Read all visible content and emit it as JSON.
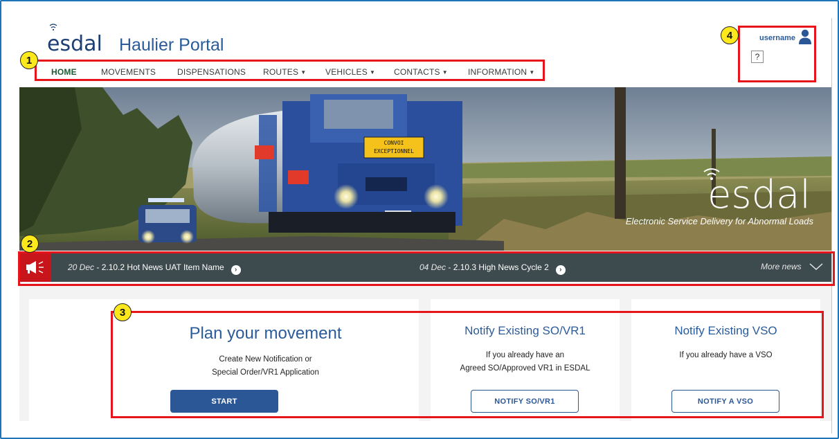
{
  "header": {
    "logo_text": "esdal",
    "portal_title": "Haulier Portal"
  },
  "nav": {
    "items": [
      {
        "label": "HOME",
        "active": true,
        "dropdown": false
      },
      {
        "label": "MOVEMENTS",
        "active": false,
        "dropdown": false
      },
      {
        "label": "DISPENSATIONS",
        "active": false,
        "dropdown": false
      },
      {
        "label": "ROUTES",
        "active": false,
        "dropdown": true
      },
      {
        "label": "VEHICLES",
        "active": false,
        "dropdown": true
      },
      {
        "label": "CONTACTS",
        "active": false,
        "dropdown": true
      },
      {
        "label": "INFORMATION",
        "active": false,
        "dropdown": true
      }
    ]
  },
  "user": {
    "username": "username",
    "help_label": "?",
    "icon": "user-icon"
  },
  "hero": {
    "logo_text": "esdal",
    "tagline": "Electronic Service Delivery for Abnormal Loads",
    "truck_sign_line1": "CONVOI",
    "truck_sign_line2": "EXCEPTIONNEL"
  },
  "news": {
    "icon": "megaphone-icon",
    "items": [
      {
        "date": "20 Dec",
        "separator": " - ",
        "title": "2.10.2 Hot News UAT Item Name"
      },
      {
        "date": "04 Dec",
        "separator": " - ",
        "title": "2.10.3 High News Cycle 2"
      }
    ],
    "more_label": "More news"
  },
  "cards": [
    {
      "title": "Plan your movement",
      "desc_line1": "Create New Notification or",
      "desc_line2": "Special Order/VR1 Application",
      "button": "START"
    },
    {
      "title": "Notify Existing SO/VR1",
      "desc_line1": "If you already have an",
      "desc_line2": "Agreed SO/Approved VR1 in ESDAL",
      "button": "NOTIFY SO/VR1"
    },
    {
      "title": "Notify Existing VSO",
      "desc_line1": "If you already have a VSO",
      "desc_line2": "",
      "button": "NOTIFY A VSO"
    }
  ],
  "annotations": {
    "markers": [
      "1",
      "2",
      "3",
      "4"
    ]
  },
  "colors": {
    "frame": "#1f73b7",
    "brand_blue": "#2b5797",
    "nav_active": "#1e5a34",
    "news_bar": "#3d4a4e",
    "news_icon_bg": "#c8151b",
    "annotation_red": "#e8141b",
    "annotation_yellow": "#fde81b"
  }
}
